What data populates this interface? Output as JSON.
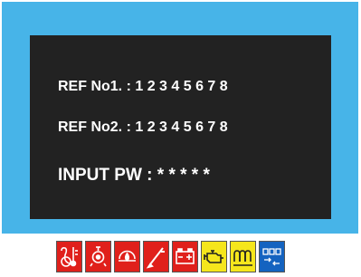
{
  "screen": {
    "ref1_label": "REF No1. :",
    "ref1_value": "1 2 3 4 5 6 7 8",
    "ref2_label": "REF No2. :",
    "ref2_value": "1 2 3 4 5 6 7 8",
    "pw_label": "INPUT PW :",
    "pw_value": "* * * * *"
  },
  "indicators": [
    {
      "name": "coolant-temperature-icon",
      "color": "#e0201b"
    },
    {
      "name": "oil-pressure-icon",
      "color": "#e0201b"
    },
    {
      "name": "fuel-pressure-icon",
      "color": "#e0201b"
    },
    {
      "name": "low-fuel-level-icon",
      "color": "#e0201b"
    },
    {
      "name": "battery-charge-icon",
      "color": "#e0201b"
    },
    {
      "name": "check-engine-icon",
      "color": "#f5e61c"
    },
    {
      "name": "glow-plug-icon",
      "color": "#f5e61c"
    },
    {
      "name": "communication-icon",
      "color": "#1463c0"
    }
  ],
  "colors": {
    "frame": "#47b4e8",
    "screen": "#222222",
    "text": "#ffffff"
  }
}
